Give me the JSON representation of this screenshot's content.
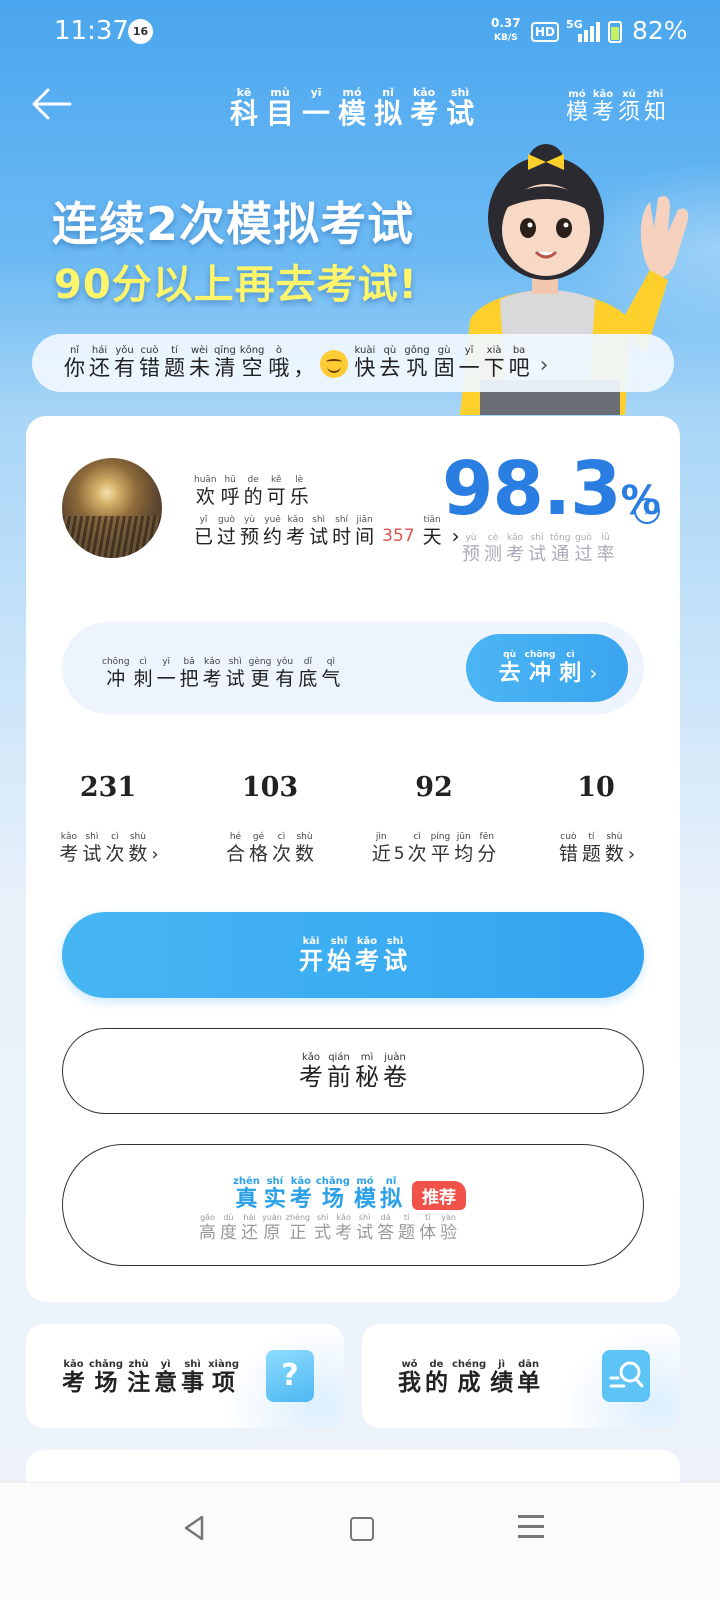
{
  "status_bar": {
    "time": "11:37",
    "notif_count": "16",
    "net_speed_value": "0.37",
    "net_speed_unit": "KB/S",
    "hd": "HD",
    "signal": "5G",
    "battery": "82%"
  },
  "header": {
    "title": [
      {
        "py": "kē",
        "hz": "科"
      },
      {
        "py": "mù",
        "hz": "目"
      },
      {
        "py": "yī",
        "hz": "一"
      },
      {
        "py": "mó",
        "hz": "模"
      },
      {
        "py": "nǐ",
        "hz": "拟"
      },
      {
        "py": "kǎo",
        "hz": "考"
      },
      {
        "py": "shì",
        "hz": "试"
      }
    ],
    "guide": [
      {
        "py": "mó",
        "hz": "模"
      },
      {
        "py": "kǎo",
        "hz": "考"
      },
      {
        "py": "xū",
        "hz": "须"
      },
      {
        "py": "zhī",
        "hz": "知"
      }
    ]
  },
  "banner": {
    "line1": "连续2次模拟考试",
    "line2": "90分以上再去考试!"
  },
  "tips": {
    "part1": [
      {
        "py": "nǐ",
        "hz": "你"
      },
      {
        "py": "hái",
        "hz": "还"
      },
      {
        "py": "yǒu",
        "hz": "有"
      },
      {
        "py": "cuò",
        "hz": "错"
      },
      {
        "py": "tí",
        "hz": "题"
      },
      {
        "py": "wèi",
        "hz": "未"
      },
      {
        "py": "qīng",
        "hz": "清"
      },
      {
        "py": "kōng",
        "hz": "空"
      },
      {
        "py": "ò",
        "hz": "哦"
      },
      {
        "py": "",
        "hz": "，"
      }
    ],
    "part2": [
      {
        "py": "kuài",
        "hz": "快"
      },
      {
        "py": "qù",
        "hz": "去"
      },
      {
        "py": "gǒng",
        "hz": "巩"
      },
      {
        "py": "gù",
        "hz": "固"
      },
      {
        "py": "yī",
        "hz": "一"
      },
      {
        "py": "xià",
        "hz": "下"
      },
      {
        "py": "ba",
        "hz": "吧"
      }
    ]
  },
  "profile": {
    "username": [
      {
        "py": "huān",
        "hz": "欢"
      },
      {
        "py": "hū",
        "hz": "呼"
      },
      {
        "py": "de",
        "hz": "的"
      },
      {
        "py": "kě",
        "hz": "可"
      },
      {
        "py": "lè",
        "hz": "乐"
      }
    ],
    "passed_label": [
      {
        "py": "yǐ",
        "hz": "已"
      },
      {
        "py": "guò",
        "hz": "过"
      },
      {
        "py": "yù",
        "hz": "预"
      },
      {
        "py": "yuē",
        "hz": "约"
      },
      {
        "py": "kǎo",
        "hz": "考"
      },
      {
        "py": "shì",
        "hz": "试"
      },
      {
        "py": "shí",
        "hz": "时"
      },
      {
        "py": "jiān",
        "hz": "间"
      }
    ],
    "days_value": "357",
    "days_unit": {
      "py": "tiān",
      "hz": "天"
    }
  },
  "pass_rate": {
    "value": "98.3",
    "unit": "%",
    "label": [
      {
        "py": "yù",
        "hz": "预"
      },
      {
        "py": "cè",
        "hz": "测"
      },
      {
        "py": "kǎo",
        "hz": "考"
      },
      {
        "py": "shì",
        "hz": "试"
      },
      {
        "py": "tōng",
        "hz": "通"
      },
      {
        "py": "guò",
        "hz": "过"
      },
      {
        "py": "lǜ",
        "hz": "率"
      }
    ]
  },
  "sprint": {
    "text": [
      {
        "py": "chōng",
        "hz": "冲"
      },
      {
        "py": "cì",
        "hz": "刺"
      },
      {
        "py": "yī",
        "hz": "一"
      },
      {
        "py": "bǎ",
        "hz": "把"
      },
      {
        "py": "kǎo",
        "hz": "考"
      },
      {
        "py": "shì",
        "hz": "试"
      },
      {
        "py": "gèng",
        "hz": "更"
      },
      {
        "py": "yǒu",
        "hz": "有"
      },
      {
        "py": "dǐ",
        "hz": "底"
      },
      {
        "py": "qì",
        "hz": "气"
      }
    ],
    "button": [
      {
        "py": "qù",
        "hz": "去"
      },
      {
        "py": "chōng",
        "hz": "冲"
      },
      {
        "py": "cì",
        "hz": "刺"
      }
    ]
  },
  "stats": [
    {
      "value": "231",
      "label": [
        {
          "py": "kǎo",
          "hz": "考"
        },
        {
          "py": "shì",
          "hz": "试"
        },
        {
          "py": "cì",
          "hz": "次"
        },
        {
          "py": "shù",
          "hz": "数"
        }
      ],
      "arrow": true
    },
    {
      "value": "103",
      "label": [
        {
          "py": "hé",
          "hz": "合"
        },
        {
          "py": "gé",
          "hz": "格"
        },
        {
          "py": "cì",
          "hz": "次"
        },
        {
          "py": "shù",
          "hz": "数"
        }
      ],
      "arrow": false
    },
    {
      "value": "92",
      "label": [
        {
          "py": "jìn",
          "hz": "近"
        },
        {
          "py": "",
          "hz": "5"
        },
        {
          "py": "cì",
          "hz": "次"
        },
        {
          "py": "píng",
          "hz": "平"
        },
        {
          "py": "jūn",
          "hz": "均"
        },
        {
          "py": "fēn",
          "hz": "分"
        }
      ],
      "arrow": false
    },
    {
      "value": "10",
      "label": [
        {
          "py": "cuò",
          "hz": "错"
        },
        {
          "py": "tí",
          "hz": "题"
        },
        {
          "py": "shù",
          "hz": "数"
        }
      ],
      "arrow": true
    }
  ],
  "buttons": {
    "start": [
      {
        "py": "kāi",
        "hz": "开"
      },
      {
        "py": "shǐ",
        "hz": "始"
      },
      {
        "py": "kǎo",
        "hz": "考"
      },
      {
        "py": "shì",
        "hz": "试"
      }
    ],
    "secret": [
      {
        "py": "kǎo",
        "hz": "考"
      },
      {
        "py": "qián",
        "hz": "前"
      },
      {
        "py": "mì",
        "hz": "秘"
      },
      {
        "py": "juàn",
        "hz": "卷"
      }
    ],
    "real_title": [
      {
        "py": "zhēn",
        "hz": "真"
      },
      {
        "py": "shí",
        "hz": "实"
      },
      {
        "py": "kǎo",
        "hz": "考"
      },
      {
        "py": "chǎng",
        "hz": "场"
      },
      {
        "py": "mó",
        "hz": "模"
      },
      {
        "py": "nǐ",
        "hz": "拟"
      }
    ],
    "real_badge": "推荐",
    "real_sub": [
      {
        "py": "gāo",
        "hz": "高"
      },
      {
        "py": "dù",
        "hz": "度"
      },
      {
        "py": "hái",
        "hz": "还"
      },
      {
        "py": "yuán",
        "hz": "原"
      },
      {
        "py": "zhèng",
        "hz": "正"
      },
      {
        "py": "shì",
        "hz": "式"
      },
      {
        "py": "kǎo",
        "hz": "考"
      },
      {
        "py": "shì",
        "hz": "试"
      },
      {
        "py": "dá",
        "hz": "答"
      },
      {
        "py": "tí",
        "hz": "题"
      },
      {
        "py": "tǐ",
        "hz": "体"
      },
      {
        "py": "yàn",
        "hz": "验"
      }
    ]
  },
  "mini_cards": [
    {
      "label": [
        {
          "py": "kǎo",
          "hz": "考"
        },
        {
          "py": "chǎng",
          "hz": "场"
        },
        {
          "py": "zhù",
          "hz": "注"
        },
        {
          "py": "yì",
          "hz": "意"
        },
        {
          "py": "shì",
          "hz": "事"
        },
        {
          "py": "xiàng",
          "hz": "项"
        }
      ],
      "icon": "question-icon"
    },
    {
      "label": [
        {
          "py": "wǒ",
          "hz": "我"
        },
        {
          "py": "de",
          "hz": "的"
        },
        {
          "py": "chéng",
          "hz": "成"
        },
        {
          "py": "jì",
          "hz": "绩"
        },
        {
          "py": "dān",
          "hz": "单"
        }
      ],
      "icon": "report-search-icon"
    }
  ],
  "colors": {
    "accent": "#2a7de1",
    "button": "#3aa5ef",
    "badge": "#f0524a",
    "days": "#d9534f"
  }
}
